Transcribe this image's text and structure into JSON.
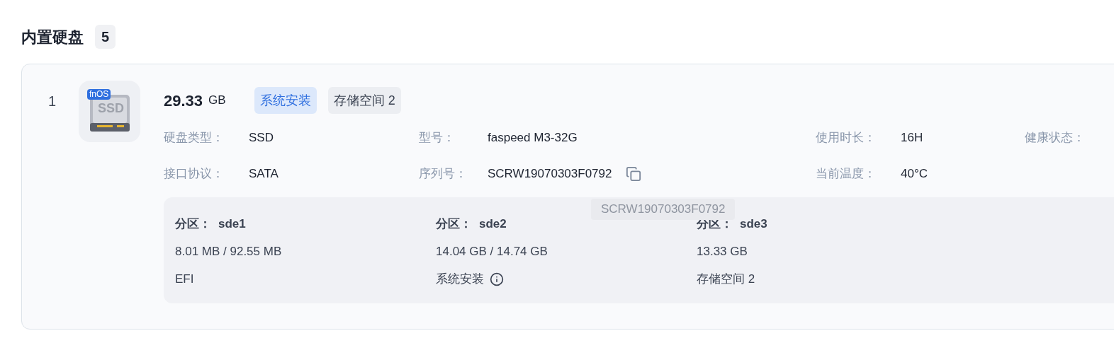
{
  "section": {
    "title": "内置硬盘",
    "count": "5"
  },
  "disks": [
    {
      "index": "1",
      "icon_badge": "fnOS",
      "icon_label": "SSD",
      "size": "29.33",
      "unit": "GB",
      "tags": [
        {
          "label": "系统安装",
          "kind": "system"
        },
        {
          "label": "存储空间 2",
          "kind": "storage"
        }
      ],
      "info": [
        {
          "label": "硬盘类型：",
          "value": "SSD"
        },
        {
          "label": "型号：",
          "value": "faspeed M3-32G"
        },
        {
          "label": "使用时长：",
          "value": "16H"
        },
        {
          "label": "健康状态："
        },
        {
          "label": "接口协议：",
          "value": "SATA"
        },
        {
          "label": "序列号：",
          "value": "SCRW19070303F0792",
          "copyable": true
        },
        {
          "label": "当前温度：",
          "value": "40°C"
        }
      ],
      "partitions": [
        {
          "label": "分区：",
          "name": "sde1",
          "usage": "8.01 MB / 92.55 MB",
          "role": "EFI",
          "info_icon": false
        },
        {
          "label": "分区：",
          "name": "sde2",
          "usage": "14.04 GB / 14.74 GB",
          "role": "系统安装",
          "info_icon": true
        },
        {
          "label": "分区：",
          "name": "sde3",
          "usage": "13.33 GB",
          "role": "存储空间 2",
          "info_icon": false
        }
      ],
      "tooltip": "SCRW19070303F0792"
    }
  ]
}
